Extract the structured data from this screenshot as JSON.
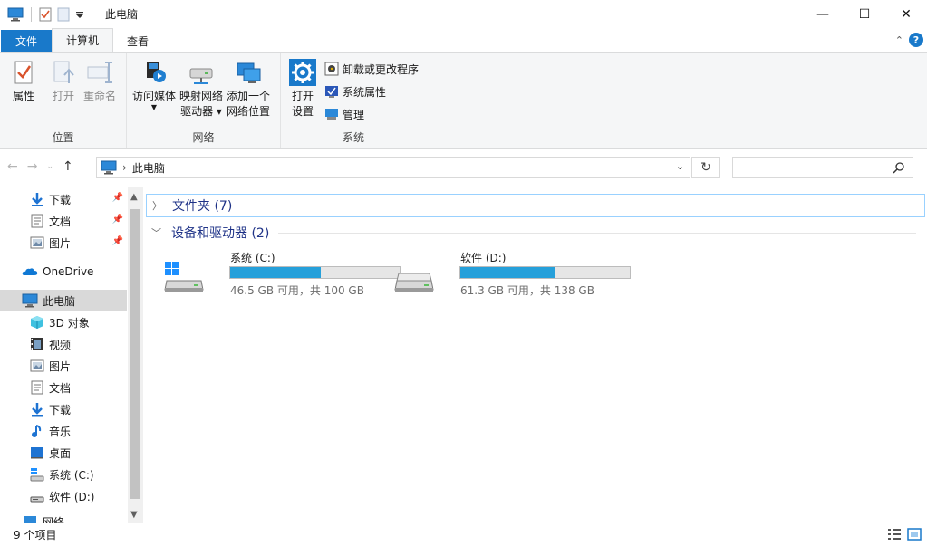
{
  "window": {
    "title": "此电脑",
    "minimize": "—",
    "maximize": "☐",
    "close": "✕"
  },
  "ribbon_tabs": [
    {
      "label": "文件"
    },
    {
      "label": "计算机"
    },
    {
      "label": "查看"
    }
  ],
  "ribbon": {
    "location": {
      "label": "位置",
      "properties": "属性",
      "open": "打开",
      "rename": "重命名"
    },
    "network": {
      "label": "网络",
      "access_media": "访问媒体",
      "map_drive_1": "映射网络",
      "map_drive_2": "驱动器 ▾",
      "add_location_1": "添加一个",
      "add_location_2": "网络位置"
    },
    "system": {
      "label": "系统",
      "open_settings_1": "打开",
      "open_settings_2": "设置",
      "uninstall": "卸载或更改程序",
      "system_properties": "系统属性",
      "manage": "管理"
    }
  },
  "address": {
    "path": "此电脑",
    "search_placeholder": ""
  },
  "sidebar": {
    "quick_access": [
      {
        "label": "下载",
        "icon": "download-icon",
        "pinned": true
      },
      {
        "label": "文档",
        "icon": "document-icon",
        "pinned": true
      },
      {
        "label": "图片",
        "icon": "picture-icon",
        "pinned": true
      }
    ],
    "onedrive": "OneDrive",
    "this_pc": "此电脑",
    "this_pc_items": [
      {
        "label": "3D 对象",
        "icon": "3d-objects-icon"
      },
      {
        "label": "视频",
        "icon": "video-icon"
      },
      {
        "label": "图片",
        "icon": "picture-icon"
      },
      {
        "label": "文档",
        "icon": "document-icon"
      },
      {
        "label": "下载",
        "icon": "download-icon"
      },
      {
        "label": "音乐",
        "icon": "music-icon"
      },
      {
        "label": "桌面",
        "icon": "desktop-icon"
      },
      {
        "label": "系统 (C:)",
        "icon": "drive-c-icon"
      },
      {
        "label": "软件 (D:)",
        "icon": "drive-d-icon"
      }
    ],
    "network_partial": "网络"
  },
  "content": {
    "folders_header": "文件夹 (7)",
    "devices_header": "设备和驱动器 (2)",
    "drives": [
      {
        "name": "系统 (C:)",
        "free": "46.5 GB 可用，共 100 GB",
        "used_fraction": 0.535
      },
      {
        "name": "软件 (D:)",
        "free": "61.3 GB 可用，共 138 GB",
        "used_fraction": 0.556
      }
    ]
  },
  "status": {
    "item_count": "9 个项目"
  },
  "colors": {
    "accent": "#1979ca",
    "drive_bar": "#26a0da",
    "section_text": "#1e3287"
  }
}
